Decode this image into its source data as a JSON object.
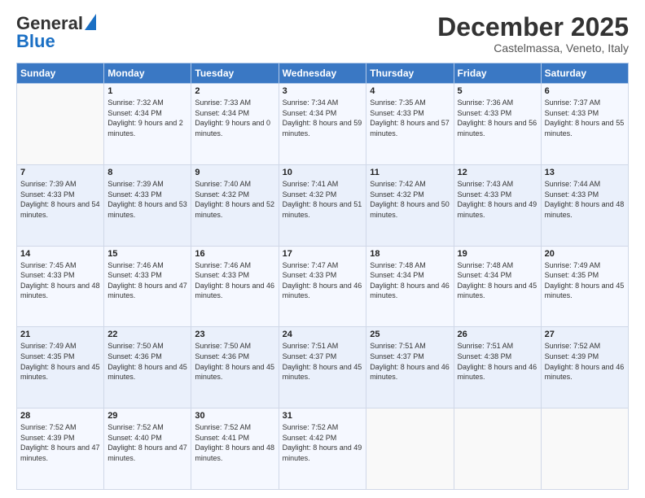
{
  "header": {
    "logo_general": "General",
    "logo_blue": "Blue",
    "month_title": "December 2025",
    "location": "Castelmassa, Veneto, Italy"
  },
  "calendar": {
    "days_of_week": [
      "Sunday",
      "Monday",
      "Tuesday",
      "Wednesday",
      "Thursday",
      "Friday",
      "Saturday"
    ],
    "weeks": [
      [
        {
          "day": "",
          "sunrise": "",
          "sunset": "",
          "daylight": ""
        },
        {
          "day": "1",
          "sunrise": "Sunrise: 7:32 AM",
          "sunset": "Sunset: 4:34 PM",
          "daylight": "Daylight: 9 hours and 2 minutes."
        },
        {
          "day": "2",
          "sunrise": "Sunrise: 7:33 AM",
          "sunset": "Sunset: 4:34 PM",
          "daylight": "Daylight: 9 hours and 0 minutes."
        },
        {
          "day": "3",
          "sunrise": "Sunrise: 7:34 AM",
          "sunset": "Sunset: 4:34 PM",
          "daylight": "Daylight: 8 hours and 59 minutes."
        },
        {
          "day": "4",
          "sunrise": "Sunrise: 7:35 AM",
          "sunset": "Sunset: 4:33 PM",
          "daylight": "Daylight: 8 hours and 57 minutes."
        },
        {
          "day": "5",
          "sunrise": "Sunrise: 7:36 AM",
          "sunset": "Sunset: 4:33 PM",
          "daylight": "Daylight: 8 hours and 56 minutes."
        },
        {
          "day": "6",
          "sunrise": "Sunrise: 7:37 AM",
          "sunset": "Sunset: 4:33 PM",
          "daylight": "Daylight: 8 hours and 55 minutes."
        }
      ],
      [
        {
          "day": "7",
          "sunrise": "Sunrise: 7:39 AM",
          "sunset": "Sunset: 4:33 PM",
          "daylight": "Daylight: 8 hours and 54 minutes."
        },
        {
          "day": "8",
          "sunrise": "Sunrise: 7:39 AM",
          "sunset": "Sunset: 4:33 PM",
          "daylight": "Daylight: 8 hours and 53 minutes."
        },
        {
          "day": "9",
          "sunrise": "Sunrise: 7:40 AM",
          "sunset": "Sunset: 4:32 PM",
          "daylight": "Daylight: 8 hours and 52 minutes."
        },
        {
          "day": "10",
          "sunrise": "Sunrise: 7:41 AM",
          "sunset": "Sunset: 4:32 PM",
          "daylight": "Daylight: 8 hours and 51 minutes."
        },
        {
          "day": "11",
          "sunrise": "Sunrise: 7:42 AM",
          "sunset": "Sunset: 4:32 PM",
          "daylight": "Daylight: 8 hours and 50 minutes."
        },
        {
          "day": "12",
          "sunrise": "Sunrise: 7:43 AM",
          "sunset": "Sunset: 4:33 PM",
          "daylight": "Daylight: 8 hours and 49 minutes."
        },
        {
          "day": "13",
          "sunrise": "Sunrise: 7:44 AM",
          "sunset": "Sunset: 4:33 PM",
          "daylight": "Daylight: 8 hours and 48 minutes."
        }
      ],
      [
        {
          "day": "14",
          "sunrise": "Sunrise: 7:45 AM",
          "sunset": "Sunset: 4:33 PM",
          "daylight": "Daylight: 8 hours and 48 minutes."
        },
        {
          "day": "15",
          "sunrise": "Sunrise: 7:46 AM",
          "sunset": "Sunset: 4:33 PM",
          "daylight": "Daylight: 8 hours and 47 minutes."
        },
        {
          "day": "16",
          "sunrise": "Sunrise: 7:46 AM",
          "sunset": "Sunset: 4:33 PM",
          "daylight": "Daylight: 8 hours and 46 minutes."
        },
        {
          "day": "17",
          "sunrise": "Sunrise: 7:47 AM",
          "sunset": "Sunset: 4:33 PM",
          "daylight": "Daylight: 8 hours and 46 minutes."
        },
        {
          "day": "18",
          "sunrise": "Sunrise: 7:48 AM",
          "sunset": "Sunset: 4:34 PM",
          "daylight": "Daylight: 8 hours and 46 minutes."
        },
        {
          "day": "19",
          "sunrise": "Sunrise: 7:48 AM",
          "sunset": "Sunset: 4:34 PM",
          "daylight": "Daylight: 8 hours and 45 minutes."
        },
        {
          "day": "20",
          "sunrise": "Sunrise: 7:49 AM",
          "sunset": "Sunset: 4:35 PM",
          "daylight": "Daylight: 8 hours and 45 minutes."
        }
      ],
      [
        {
          "day": "21",
          "sunrise": "Sunrise: 7:49 AM",
          "sunset": "Sunset: 4:35 PM",
          "daylight": "Daylight: 8 hours and 45 minutes."
        },
        {
          "day": "22",
          "sunrise": "Sunrise: 7:50 AM",
          "sunset": "Sunset: 4:36 PM",
          "daylight": "Daylight: 8 hours and 45 minutes."
        },
        {
          "day": "23",
          "sunrise": "Sunrise: 7:50 AM",
          "sunset": "Sunset: 4:36 PM",
          "daylight": "Daylight: 8 hours and 45 minutes."
        },
        {
          "day": "24",
          "sunrise": "Sunrise: 7:51 AM",
          "sunset": "Sunset: 4:37 PM",
          "daylight": "Daylight: 8 hours and 45 minutes."
        },
        {
          "day": "25",
          "sunrise": "Sunrise: 7:51 AM",
          "sunset": "Sunset: 4:37 PM",
          "daylight": "Daylight: 8 hours and 46 minutes."
        },
        {
          "day": "26",
          "sunrise": "Sunrise: 7:51 AM",
          "sunset": "Sunset: 4:38 PM",
          "daylight": "Daylight: 8 hours and 46 minutes."
        },
        {
          "day": "27",
          "sunrise": "Sunrise: 7:52 AM",
          "sunset": "Sunset: 4:39 PM",
          "daylight": "Daylight: 8 hours and 46 minutes."
        }
      ],
      [
        {
          "day": "28",
          "sunrise": "Sunrise: 7:52 AM",
          "sunset": "Sunset: 4:39 PM",
          "daylight": "Daylight: 8 hours and 47 minutes."
        },
        {
          "day": "29",
          "sunrise": "Sunrise: 7:52 AM",
          "sunset": "Sunset: 4:40 PM",
          "daylight": "Daylight: 8 hours and 47 minutes."
        },
        {
          "day": "30",
          "sunrise": "Sunrise: 7:52 AM",
          "sunset": "Sunset: 4:41 PM",
          "daylight": "Daylight: 8 hours and 48 minutes."
        },
        {
          "day": "31",
          "sunrise": "Sunrise: 7:52 AM",
          "sunset": "Sunset: 4:42 PM",
          "daylight": "Daylight: 8 hours and 49 minutes."
        },
        {
          "day": "",
          "sunrise": "",
          "sunset": "",
          "daylight": ""
        },
        {
          "day": "",
          "sunrise": "",
          "sunset": "",
          "daylight": ""
        },
        {
          "day": "",
          "sunrise": "",
          "sunset": "",
          "daylight": ""
        }
      ]
    ]
  }
}
